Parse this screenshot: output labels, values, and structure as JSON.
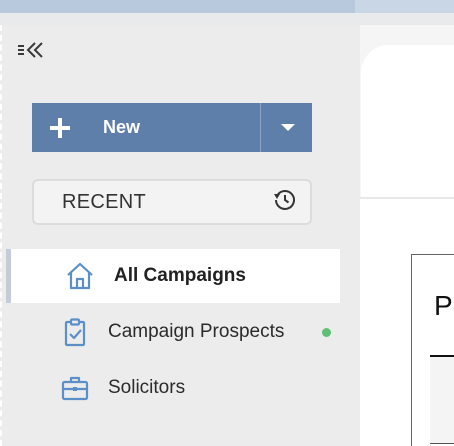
{
  "sidebar": {
    "new_button": {
      "label": "New"
    },
    "recent": {
      "label": "RECENT"
    },
    "items": [
      {
        "label": "All Campaigns",
        "icon": "home-icon",
        "active": true
      },
      {
        "label": "Campaign Prospects",
        "icon": "clipboard-check-icon",
        "status": "green-dot"
      },
      {
        "label": "Solicitors",
        "icon": "briefcase-icon"
      }
    ]
  },
  "main": {
    "panel_title": "P"
  },
  "colors": {
    "accent": "#5f7fab",
    "icon": "#5a8fc8",
    "status_dot": "#5fbf74"
  }
}
